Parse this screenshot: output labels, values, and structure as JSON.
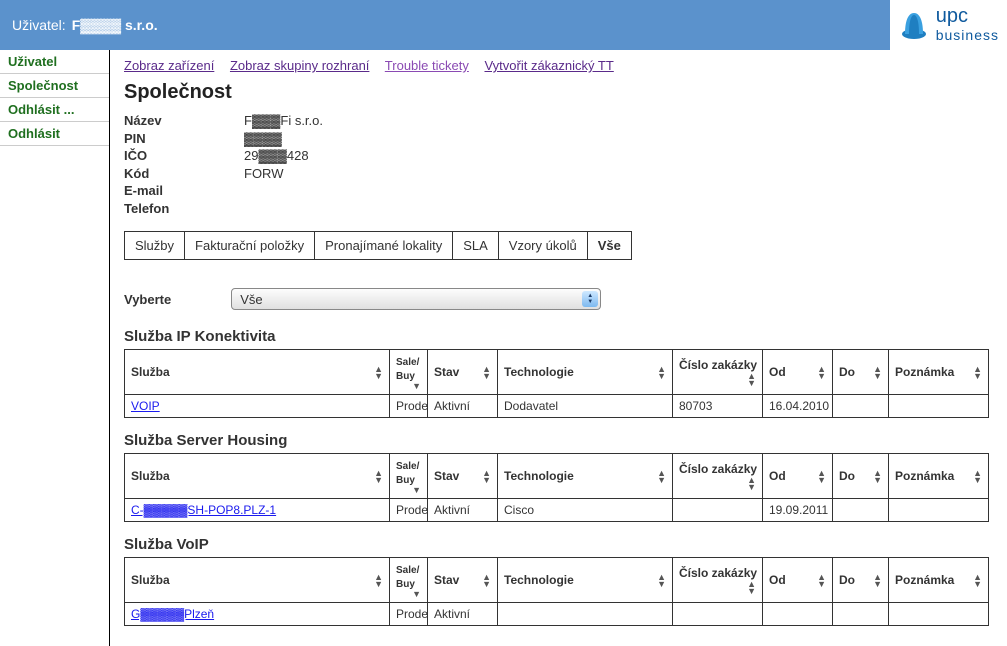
{
  "header": {
    "user_label": "Uživatel:",
    "user_company": "F▓▓▓▓ s.r.o.",
    "logo_name": "upc",
    "logo_sub": "business"
  },
  "sidebar": {
    "items": [
      {
        "label": "Uživatel"
      },
      {
        "label": "Společnost"
      },
      {
        "label": "Odhlásit ..."
      },
      {
        "label": "Odhlásit"
      }
    ]
  },
  "toplinks": [
    "Zobraz zařízení",
    "Zobraz skupiny rozhraní",
    "Trouble tickety",
    "Vytvořit zákaznický TT"
  ],
  "page_title": "Společnost",
  "details": {
    "rows": [
      {
        "label": "Název",
        "value": "F▓▓▓Fi s.r.o."
      },
      {
        "label": "PIN",
        "value": "▓▓▓▓"
      },
      {
        "label": "IČO",
        "value": "29▓▓▓428"
      },
      {
        "label": "Kód",
        "value": "FORW"
      },
      {
        "label": "E-mail",
        "value": ""
      },
      {
        "label": "Telefon",
        "value": ""
      }
    ]
  },
  "tabs": [
    "Služby",
    "Fakturační položky",
    "Pronajímané lokality",
    "SLA",
    "Vzory úkolů",
    "Vše"
  ],
  "tabs_active_index": 5,
  "filter": {
    "label": "Vyberte",
    "value": "Vše"
  },
  "table_headers": {
    "sluzba": "Služba",
    "salebuy_l1": "Sale/",
    "salebuy_l2": "Buy",
    "stav": "Stav",
    "tech": "Technologie",
    "zak": "Číslo zakázky",
    "od": "Od",
    "do": "Do",
    "poz": "Poznámka"
  },
  "sections": [
    {
      "title": "Služba IP Konektivita",
      "rows": [
        {
          "sluzba": "VOIP",
          "sb": "Prodej",
          "stav": "Aktivní",
          "tech": "Dodavatel",
          "zak": "80703",
          "od": "16.04.2010",
          "do": "",
          "poz": ""
        }
      ]
    },
    {
      "title": "Služba Server Housing",
      "rows": [
        {
          "sluzba": "C-▓▓▓▓▓SH-POP8.PLZ-1",
          "sb": "Prodej",
          "stav": "Aktivní",
          "tech": "Cisco",
          "zak": "",
          "od": "19.09.2011",
          "do": "",
          "poz": ""
        }
      ]
    },
    {
      "title": "Služba VoIP",
      "rows": [
        {
          "sluzba": "G▓▓▓▓▓Plzeň",
          "sb": "Prodej",
          "stav": "Aktivní",
          "tech": "",
          "zak": "",
          "od": "",
          "do": "",
          "poz": ""
        }
      ]
    }
  ]
}
